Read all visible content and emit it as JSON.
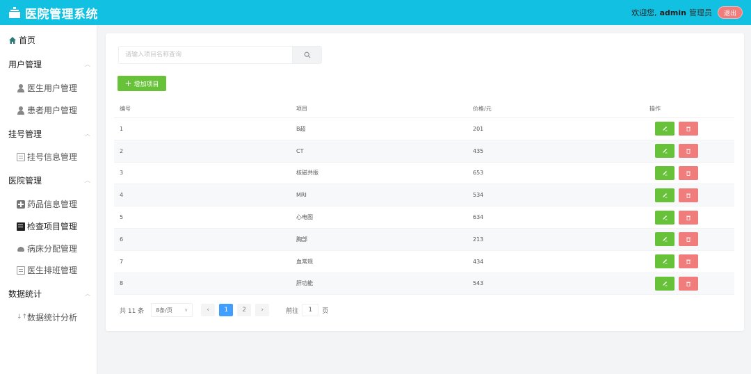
{
  "header": {
    "title": "医院管理系统",
    "welcome": "欢迎您,",
    "username": "admin",
    "role": "管理员",
    "logout_label": "退出"
  },
  "sidebar": {
    "home": "首页",
    "groups": [
      {
        "label": "用户管理",
        "items": [
          "医生用户管理",
          "患者用户管理"
        ]
      },
      {
        "label": "挂号管理",
        "items": [
          "挂号信息管理"
        ]
      },
      {
        "label": "医院管理",
        "items": [
          "药品信息管理",
          "检查项目管理",
          "病床分配管理",
          "医生排班管理"
        ]
      },
      {
        "label": "数据统计",
        "items": [
          "数据统计分析"
        ]
      }
    ],
    "active_item": "检查项目管理"
  },
  "toolbar": {
    "search_placeholder": "请输入项目名称查询",
    "add_label": "增加项目"
  },
  "table": {
    "headers": [
      "编号",
      "项目",
      "价格/元",
      "操作"
    ],
    "rows": [
      {
        "id": "1",
        "name": "B超",
        "price": "201"
      },
      {
        "id": "2",
        "name": "CT",
        "price": "435"
      },
      {
        "id": "3",
        "name": "核磁共振",
        "price": "653"
      },
      {
        "id": "4",
        "name": "MRI",
        "price": "534"
      },
      {
        "id": "5",
        "name": "心电图",
        "price": "634"
      },
      {
        "id": "6",
        "name": "胸部",
        "price": "213"
      },
      {
        "id": "7",
        "name": "血常规",
        "price": "434"
      },
      {
        "id": "8",
        "name": "肝功能",
        "price": "543"
      }
    ]
  },
  "pagination": {
    "total": "共 11 条",
    "page_size": "8条/页",
    "pages": [
      "1",
      "2"
    ],
    "current_page": "1",
    "goto_label": "前往",
    "goto_value": "1",
    "page_unit": "页"
  },
  "colors": {
    "header_bg": "#12c0e2",
    "primary_green": "#67c23a",
    "danger": "#f07c7c",
    "active_page": "#409eff"
  }
}
